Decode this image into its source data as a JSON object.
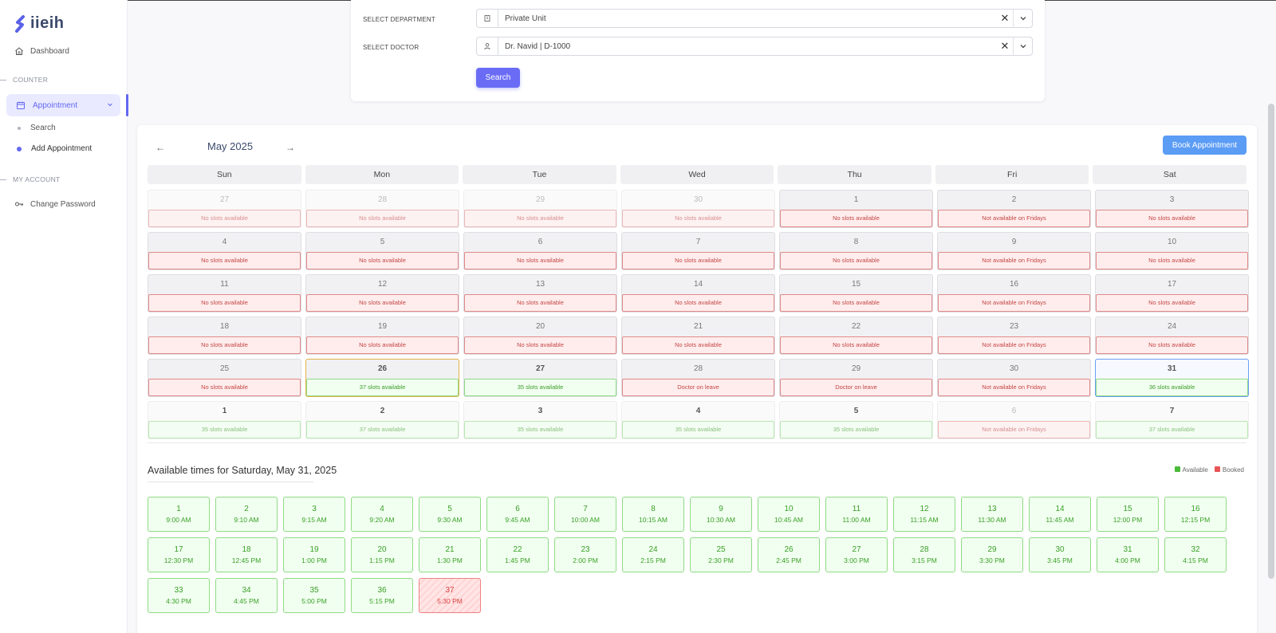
{
  "app": {
    "logo_text": "iieih"
  },
  "sidebar": {
    "dashboard": "Dashboard",
    "counter_section": "COUNTER",
    "appointment": "Appointment",
    "sub_items": [
      "Search",
      "Add Appointment"
    ],
    "account_section": "MY ACCOUNT",
    "change_password": "Change Password"
  },
  "form": {
    "department_label": "SELECT DEPARTMENT",
    "department_value": "Private Unit",
    "doctor_label": "SELECT DOCTOR",
    "doctor_value": "Dr. Navid | D-1000",
    "search_button": "Search",
    "clear_glyph": "✕"
  },
  "calendar": {
    "prev": "←",
    "next": "→",
    "month": "May 2025",
    "book_button": "Book Appointment",
    "days": [
      "Sun",
      "Mon",
      "Tue",
      "Wed",
      "Thu",
      "Fri",
      "Sat"
    ],
    "cells": [
      {
        "day": "27",
        "text": "No slots available",
        "state": "none",
        "other": true
      },
      {
        "day": "28",
        "text": "No slots available",
        "state": "none",
        "other": true
      },
      {
        "day": "29",
        "text": "No slots available",
        "state": "none",
        "other": true
      },
      {
        "day": "30",
        "text": "No slots available",
        "state": "none",
        "other": true
      },
      {
        "day": "1",
        "text": "No slots available",
        "state": "none"
      },
      {
        "day": "2",
        "text": "Not available on Fridays",
        "state": "none"
      },
      {
        "day": "3",
        "text": "No slots available",
        "state": "none"
      },
      {
        "day": "4",
        "text": "No slots available",
        "state": "none"
      },
      {
        "day": "5",
        "text": "No slots available",
        "state": "none"
      },
      {
        "day": "6",
        "text": "No slots available",
        "state": "none"
      },
      {
        "day": "7",
        "text": "No slots available",
        "state": "none"
      },
      {
        "day": "8",
        "text": "No slots available",
        "state": "none"
      },
      {
        "day": "9",
        "text": "Not available on Fridays",
        "state": "none"
      },
      {
        "day": "10",
        "text": "No slots available",
        "state": "none"
      },
      {
        "day": "11",
        "text": "No slots available",
        "state": "none"
      },
      {
        "day": "12",
        "text": "No slots available",
        "state": "none"
      },
      {
        "day": "13",
        "text": "No slots available",
        "state": "none"
      },
      {
        "day": "14",
        "text": "No slots available",
        "state": "none"
      },
      {
        "day": "15",
        "text": "No slots available",
        "state": "none"
      },
      {
        "day": "16",
        "text": "Not available on Fridays",
        "state": "none"
      },
      {
        "day": "17",
        "text": "No slots available",
        "state": "none"
      },
      {
        "day": "18",
        "text": "No slots available",
        "state": "none"
      },
      {
        "day": "19",
        "text": "No slots available",
        "state": "none"
      },
      {
        "day": "20",
        "text": "No slots available",
        "state": "none"
      },
      {
        "day": "21",
        "text": "No slots available",
        "state": "none"
      },
      {
        "day": "22",
        "text": "No slots available",
        "state": "none"
      },
      {
        "day": "23",
        "text": "Not available on Fridays",
        "state": "none"
      },
      {
        "day": "24",
        "text": "No slots available",
        "state": "none"
      },
      {
        "day": "25",
        "text": "No slots available",
        "state": "none"
      },
      {
        "day": "26",
        "text": "37 slots available",
        "state": "avail",
        "today": true
      },
      {
        "day": "27",
        "text": "35 slots available",
        "state": "avail"
      },
      {
        "day": "28",
        "text": "Doctor on leave",
        "state": "none"
      },
      {
        "day": "29",
        "text": "Doctor on leave",
        "state": "none"
      },
      {
        "day": "30",
        "text": "Not available on Fridays",
        "state": "none"
      },
      {
        "day": "31",
        "text": "36 slots available",
        "state": "avail",
        "selected": true
      },
      {
        "day": "1",
        "text": "35 slots available",
        "state": "avail",
        "other": true
      },
      {
        "day": "2",
        "text": "37 slots available",
        "state": "avail",
        "other": true
      },
      {
        "day": "3",
        "text": "35 slots available",
        "state": "avail",
        "other": true
      },
      {
        "day": "4",
        "text": "35 slots available",
        "state": "avail",
        "other": true
      },
      {
        "day": "5",
        "text": "35 slots available",
        "state": "avail",
        "other": true
      },
      {
        "day": "6",
        "text": "Not available on Fridays",
        "state": "none",
        "other": true
      },
      {
        "day": "7",
        "text": "37 slots available",
        "state": "avail",
        "other": true
      }
    ]
  },
  "times": {
    "title": "Available times for Saturday, May 31, 2025",
    "legend_available": "Available",
    "legend_booked": "Booked",
    "slots": [
      {
        "n": "1",
        "t": "9:00 AM"
      },
      {
        "n": "2",
        "t": "9:10 AM"
      },
      {
        "n": "3",
        "t": "9:15 AM"
      },
      {
        "n": "4",
        "t": "9:20 AM"
      },
      {
        "n": "5",
        "t": "9:30 AM"
      },
      {
        "n": "6",
        "t": "9:45 AM"
      },
      {
        "n": "7",
        "t": "10:00 AM"
      },
      {
        "n": "8",
        "t": "10:15 AM"
      },
      {
        "n": "9",
        "t": "10:30 AM"
      },
      {
        "n": "10",
        "t": "10:45 AM"
      },
      {
        "n": "11",
        "t": "11:00 AM"
      },
      {
        "n": "12",
        "t": "11:15 AM"
      },
      {
        "n": "13",
        "t": "11:30 AM"
      },
      {
        "n": "14",
        "t": "11:45 AM"
      },
      {
        "n": "15",
        "t": "12:00 PM"
      },
      {
        "n": "16",
        "t": "12:15 PM"
      },
      {
        "n": "17",
        "t": "12:30 PM"
      },
      {
        "n": "18",
        "t": "12:45 PM"
      },
      {
        "n": "19",
        "t": "1:00 PM"
      },
      {
        "n": "20",
        "t": "1:15 PM"
      },
      {
        "n": "21",
        "t": "1:30 PM"
      },
      {
        "n": "22",
        "t": "1:45 PM"
      },
      {
        "n": "23",
        "t": "2:00 PM"
      },
      {
        "n": "24",
        "t": "2:15 PM"
      },
      {
        "n": "25",
        "t": "2:30 PM"
      },
      {
        "n": "26",
        "t": "2:45 PM"
      },
      {
        "n": "27",
        "t": "3:00 PM"
      },
      {
        "n": "28",
        "t": "3:15 PM"
      },
      {
        "n": "29",
        "t": "3:30 PM"
      },
      {
        "n": "30",
        "t": "3:45 PM"
      },
      {
        "n": "31",
        "t": "4:00 PM"
      },
      {
        "n": "32",
        "t": "4:15 PM"
      },
      {
        "n": "33",
        "t": "4:30 PM"
      },
      {
        "n": "34",
        "t": "4:45 PM"
      },
      {
        "n": "35",
        "t": "5:00 PM"
      },
      {
        "n": "36",
        "t": "5:15 PM"
      },
      {
        "n": "37",
        "t": "5:30 PM",
        "booked": true
      }
    ]
  },
  "colors": {
    "accent": "#6468f0",
    "book": "#5b9cf5",
    "available": "#3aa028",
    "booked": "#d94040"
  },
  "icons": {
    "dashboard": "home-icon",
    "appointment": "calendar-icon",
    "change_password": "key-icon",
    "department": "building-icon",
    "doctor": "user-icon"
  }
}
